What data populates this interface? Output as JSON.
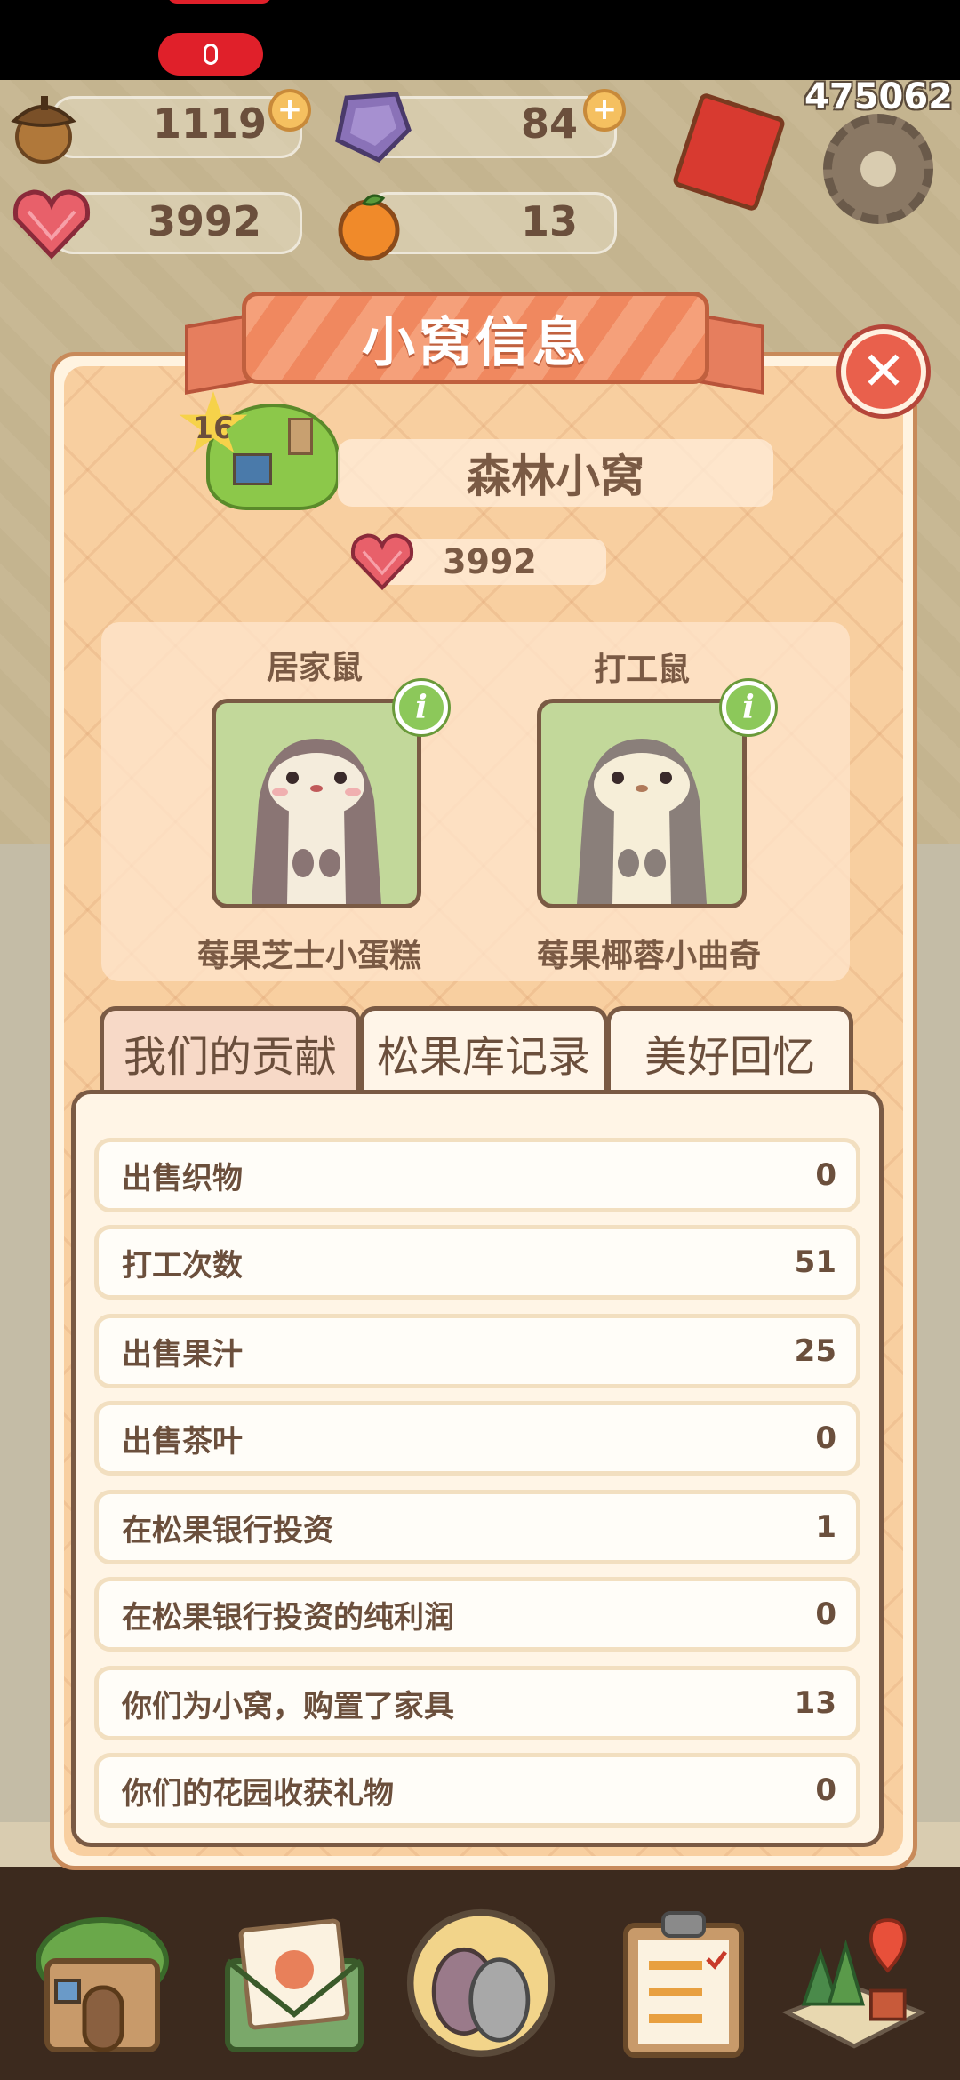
{
  "resources": {
    "acorns": "1119",
    "gems": "84",
    "hearts": "3992",
    "oranges": "13"
  },
  "top_right_id": "475062",
  "panel": {
    "title": "小窝信息",
    "nest_level": "16",
    "nest_name": "森林小窝",
    "nest_hearts": "3992"
  },
  "residents": [
    {
      "role": "居家鼠",
      "name": "莓果芝士小蛋糕"
    },
    {
      "role": "打工鼠",
      "name": "莓果椰蓉小曲奇"
    }
  ],
  "tabs": [
    {
      "label": "我们的贡献",
      "active": true
    },
    {
      "label": "松果库记录",
      "active": false
    },
    {
      "label": "美好回忆",
      "active": false
    }
  ],
  "stats": [
    {
      "label": "出售织物",
      "value": "0"
    },
    {
      "label": "打工次数",
      "value": "51"
    },
    {
      "label": "出售果汁",
      "value": "25"
    },
    {
      "label": "出售茶叶",
      "value": "0"
    },
    {
      "label": "在松果银行投资",
      "value": "1"
    },
    {
      "label": "在松果银行投资的纯利润",
      "value": "0"
    },
    {
      "label": "你们为小窝，购置了家具",
      "value": "13"
    },
    {
      "label": "你们的花园收获礼物",
      "value": "0"
    }
  ],
  "bottom_nav": [
    {
      "icon": "house-icon"
    },
    {
      "icon": "mail-icon"
    },
    {
      "icon": "mice-icon"
    },
    {
      "icon": "clipboard-icon"
    },
    {
      "icon": "map-icon"
    }
  ],
  "colors": {
    "panel_bg": "#f8cfa0",
    "ribbon": "#f0885f",
    "text_brown": "#6b4f3c",
    "close_red": "#e9604c",
    "info_green": "#8cc85a"
  }
}
